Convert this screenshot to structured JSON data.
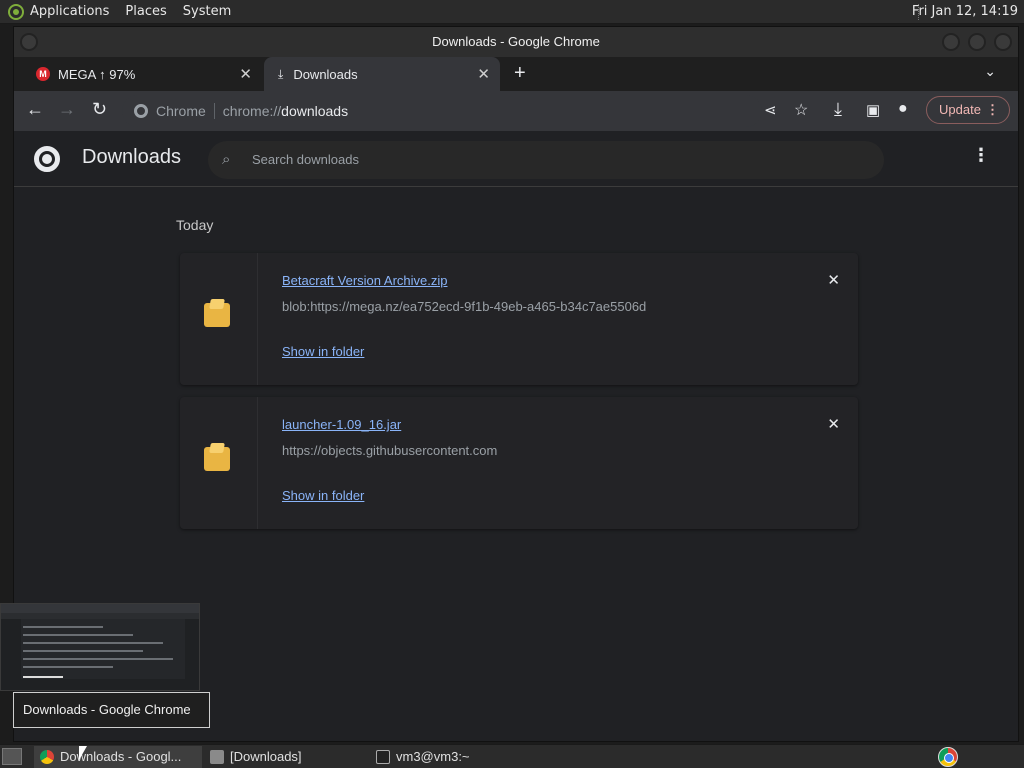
{
  "top_panel": {
    "menus": [
      "Applications",
      "Places",
      "System"
    ],
    "clock": "Fri Jan 12, 14:19"
  },
  "window": {
    "title": "Downloads - Google Chrome"
  },
  "tabs": [
    {
      "label": "MEGA ↑ 97%",
      "icon": "mega-icon"
    },
    {
      "label": "Downloads",
      "icon": "download-icon"
    }
  ],
  "toolbar": {
    "chip": "Chrome",
    "url_scheme": "chrome://",
    "url_host": "downloads",
    "update_label": "Update"
  },
  "downloads_page": {
    "title": "Downloads",
    "search_placeholder": "Search downloads",
    "date_label": "Today",
    "items": [
      {
        "file_name": "Betacraft Version Archive.zip",
        "source_url": "blob:https://mega.nz/ea752ecd-9f1b-49eb-a465-b34c7ae5506d",
        "action_label": "Show in folder"
      },
      {
        "file_name": "launcher-1.09_16.jar",
        "source_url": "https://objects.githubusercontent.com",
        "action_label": "Show in folder"
      }
    ]
  },
  "tooltip": "Downloads - Google Chrome",
  "taskbar": {
    "tasks": [
      {
        "label": "Downloads - Googl...",
        "icon": "chrome-icon"
      },
      {
        "label": "[Downloads]",
        "icon": "folder-icon"
      },
      {
        "label": "vm3@vm3:~",
        "icon": "terminal-icon"
      }
    ]
  },
  "colors": {
    "link": "#8ab4f8",
    "page_bg": "#202124",
    "update_border": "#8a5d5d"
  }
}
